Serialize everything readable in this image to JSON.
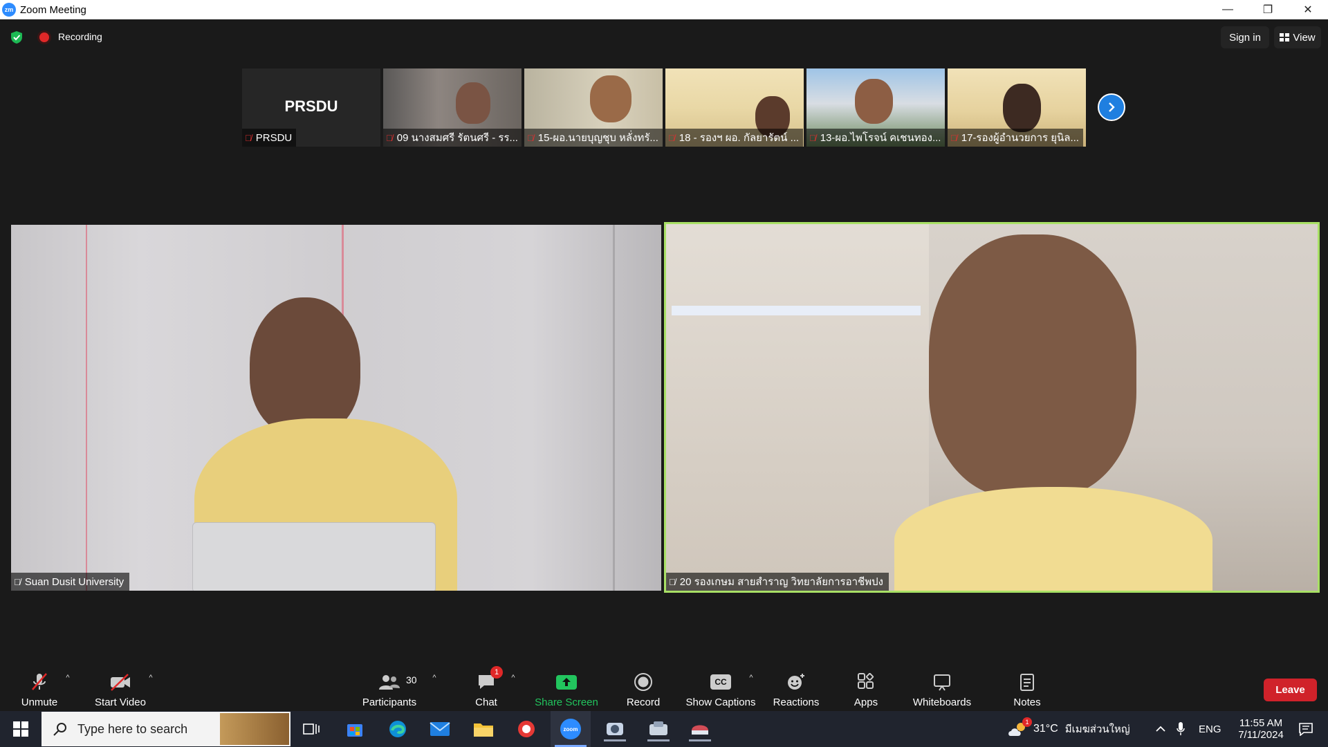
{
  "window": {
    "app_icon": "zm",
    "title": "Zoom Meeting",
    "controls": [
      "—",
      "❐",
      "✕"
    ]
  },
  "topbar": {
    "recording_label": "Recording",
    "signin_label": "Sign in",
    "view_label": "View"
  },
  "thumbnails": [
    {
      "big_label": "PRSDU",
      "name": "PRSDU"
    },
    {
      "name": "09 นางสมศรี รัตนศรี - รร..."
    },
    {
      "name": "15-ผอ.นายบุญชุบ หลั่งทรั..."
    },
    {
      "name": "18 - รองฯ ผอ. กัลยารัตน์ ..."
    },
    {
      "name": "13-ผอ.ไพโรจน์ คเชนทอง..."
    },
    {
      "name": "17-รองผู้อำนวยการ ยุนิล..."
    }
  ],
  "videos": {
    "left_name": "Suan Dusit University",
    "right_name": "20 รองเกษม สายสำราญ  วิทยาลัยการอาชีพปง"
  },
  "toolbar": {
    "unmute": "Unmute",
    "start_video": "Start Video",
    "participants": "Participants",
    "participants_count": "30",
    "chat": "Chat",
    "chat_badge": "1",
    "share_screen": "Share Screen",
    "record": "Record",
    "show_captions": "Show Captions",
    "cc_text": "CC",
    "reactions": "Reactions",
    "apps": "Apps",
    "whiteboards": "Whiteboards",
    "notes": "Notes",
    "leave": "Leave"
  },
  "taskbar": {
    "search_placeholder": "Type here to search",
    "zoom_label": "zoom",
    "weather_badge": "1",
    "weather_temp": "31°C",
    "weather_location": "มีเมฆส่วนใหญ่",
    "lang": "ENG",
    "time": "11:55 AM",
    "date": "7/11/2024"
  },
  "colors": {
    "accent_blue": "#2d8cff",
    "active_speaker": "#a8e065",
    "share_green": "#22c55e",
    "leave_red": "#d0222a",
    "record_red": "#e02828"
  }
}
